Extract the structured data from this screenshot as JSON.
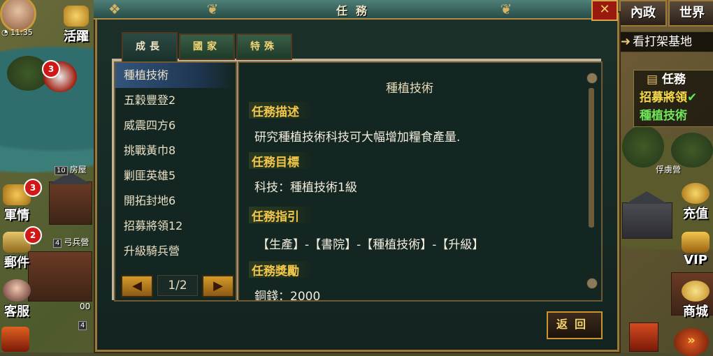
{
  "hud": {
    "time": "11:35",
    "activity": "活躍",
    "military": "軍情",
    "military_badge": "3",
    "mail": "郵件",
    "mail_badge": "2",
    "service": "客服",
    "axe_badge": "3",
    "house_level": "10",
    "house_label": "房屋",
    "archer_level": "4",
    "archer_label": "弓兵營",
    "small_level": "4",
    "small_num": "00"
  },
  "right_hud": {
    "internal_affairs": "內政",
    "world": "世界",
    "quest_bar": "看打架基地",
    "task_header": "任務",
    "task_recruit": "招募將領",
    "task_recruit_check": "✔",
    "task_current": "種植技術",
    "prison_label": "俘虜營",
    "recharge": "充值",
    "vip": "VIP",
    "shop": "商城"
  },
  "dialog": {
    "title": "任務",
    "tabs": [
      {
        "label": "成長"
      },
      {
        "label": "國家"
      },
      {
        "label": "特殊"
      }
    ],
    "list": [
      "種植技術",
      "五穀豐登2",
      "威震四方6",
      "挑戰黃巾8",
      "剿匪英雄5",
      "開拓封地6",
      "招募將領12",
      "升級騎兵營"
    ],
    "page": "1/2",
    "detail": {
      "title": "種植技術",
      "description_heading": "任務描述",
      "description": "研究種植技術科技可大幅增加糧食產量.",
      "goal_heading": "任務目標",
      "goal": "科技：種植技術1級",
      "guide_heading": "任務指引",
      "guide": "【生產】-【書院】-【種植技術】-【升級】",
      "reward_heading": "任務獎勵",
      "reward_partial": "銅錢：2000"
    },
    "back_label": "返回"
  },
  "colors": {
    "dialog_bg": "#132621",
    "heading_gold": "#f2c64a",
    "frame_gold": "#9a7a3c",
    "selected_row": "#34547c"
  }
}
